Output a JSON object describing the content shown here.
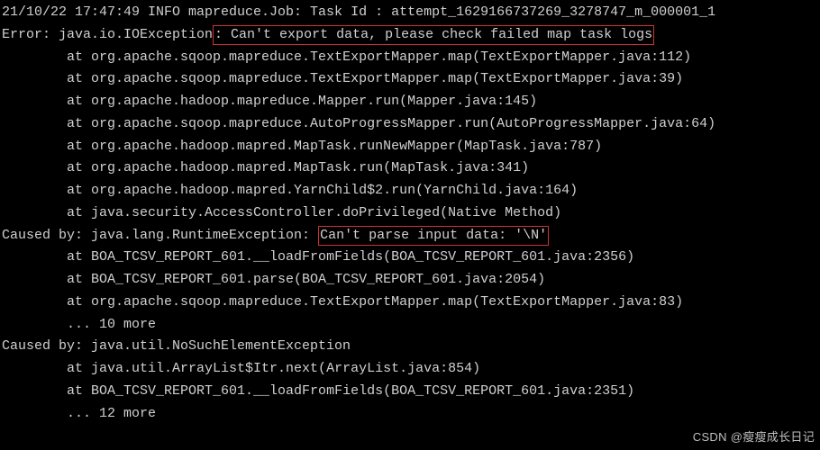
{
  "lines": [
    {
      "indent": "",
      "pre": "21/10/22 17:47:49 INFO mapreduce.Job: Task Id : attempt_1629166737269_3278747_m_000001_1",
      "hl": "",
      "post": ""
    },
    {
      "indent": "",
      "pre": "Error: java.io.IOException",
      "hl": ": Can't export data, please check failed map task logs",
      "post": ""
    },
    {
      "indent": "        ",
      "pre": "at org.apache.sqoop.mapreduce.TextExportMapper.map(TextExportMapper.java:112)",
      "hl": "",
      "post": ""
    },
    {
      "indent": "        ",
      "pre": "at org.apache.sqoop.mapreduce.TextExportMapper.map(TextExportMapper.java:39)",
      "hl": "",
      "post": ""
    },
    {
      "indent": "        ",
      "pre": "at org.apache.hadoop.mapreduce.Mapper.run(Mapper.java:145)",
      "hl": "",
      "post": ""
    },
    {
      "indent": "        ",
      "pre": "at org.apache.sqoop.mapreduce.AutoProgressMapper.run(AutoProgressMapper.java:64)",
      "hl": "",
      "post": ""
    },
    {
      "indent": "        ",
      "pre": "at org.apache.hadoop.mapred.MapTask.runNewMapper(MapTask.java:787)",
      "hl": "",
      "post": ""
    },
    {
      "indent": "        ",
      "pre": "at org.apache.hadoop.mapred.MapTask.run(MapTask.java:341)",
      "hl": "",
      "post": ""
    },
    {
      "indent": "        ",
      "pre": "at org.apache.hadoop.mapred.YarnChild$2.run(YarnChild.java:164)",
      "hl": "",
      "post": ""
    },
    {
      "indent": "        ",
      "pre": "at java.security.AccessController.doPrivileged(Native Method)",
      "hl": "",
      "post": ""
    },
    {
      "indent": "",
      "pre": "Caused by: java.lang.RuntimeException: ",
      "hl": "Can't parse input data: '\\N'",
      "post": ""
    },
    {
      "indent": "        ",
      "pre": "at BOA_TCSV_REPORT_601.__loadFromFields(BOA_TCSV_REPORT_601.java:2356)",
      "hl": "",
      "post": ""
    },
    {
      "indent": "        ",
      "pre": "at BOA_TCSV_REPORT_601.parse(BOA_TCSV_REPORT_601.java:2054)",
      "hl": "",
      "post": ""
    },
    {
      "indent": "        ",
      "pre": "at org.apache.sqoop.mapreduce.TextExportMapper.map(TextExportMapper.java:83)",
      "hl": "",
      "post": ""
    },
    {
      "indent": "        ",
      "pre": "... 10 more",
      "hl": "",
      "post": ""
    },
    {
      "indent": "",
      "pre": "Caused by: java.util.NoSuchElementException",
      "hl": "",
      "post": ""
    },
    {
      "indent": "        ",
      "pre": "at java.util.ArrayList$Itr.next(ArrayList.java:854)",
      "hl": "",
      "post": ""
    },
    {
      "indent": "        ",
      "pre": "at BOA_TCSV_REPORT_601.__loadFromFields(BOA_TCSV_REPORT_601.java:2351)",
      "hl": "",
      "post": ""
    },
    {
      "indent": "        ",
      "pre": "... 12 more",
      "hl": "",
      "post": ""
    }
  ],
  "watermark": "CSDN @瘦瘦成长日记"
}
